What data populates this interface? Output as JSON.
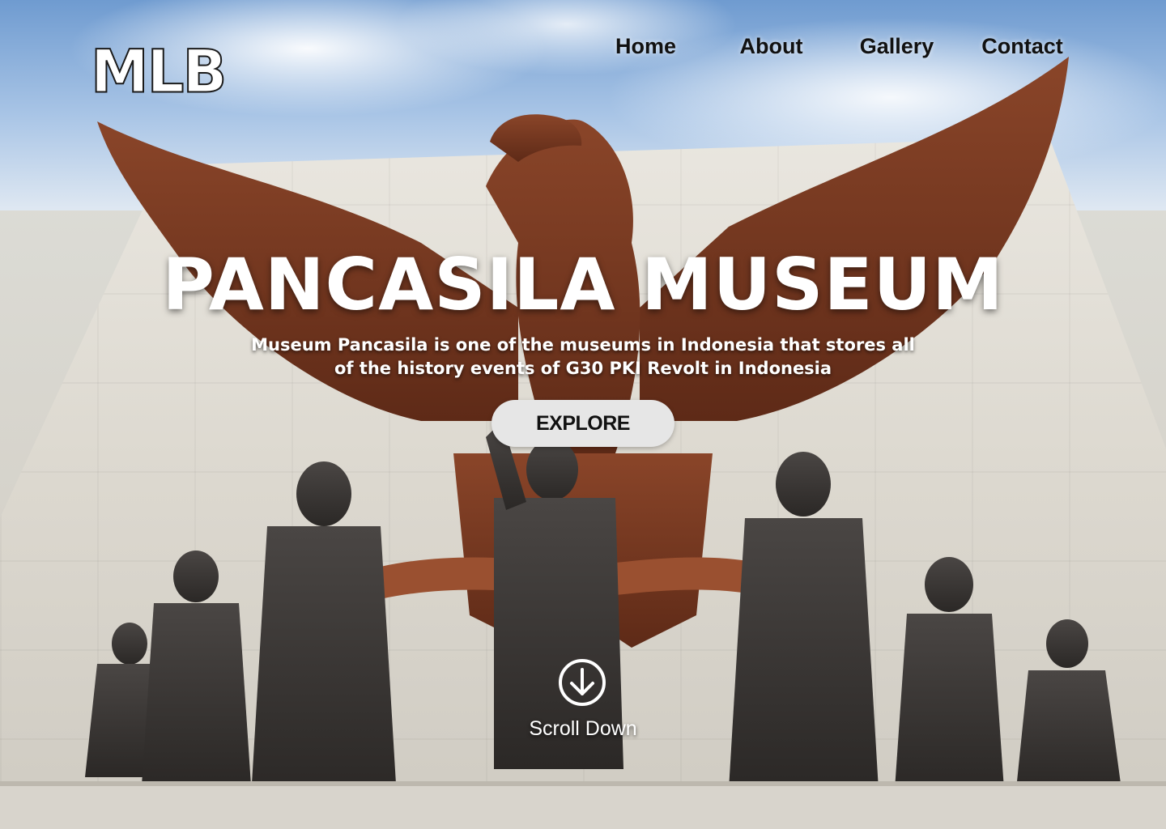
{
  "brand": {
    "logo_text": "MLB"
  },
  "nav": {
    "items": [
      {
        "label": "Home"
      },
      {
        "label": "About"
      },
      {
        "label": "Gallery"
      },
      {
        "label": "Contact"
      }
    ]
  },
  "hero": {
    "title": "PANCASILA MUSEUM",
    "description": "Museum Pancasila is one of the museums in Indonesia that stores all of the history events of G30 PKI Revolt in Indonesia",
    "cta_label": "EXPLORE",
    "scroll_label": "Scroll Down",
    "background_image": "pancasila-monument-eagle-and-statues"
  },
  "colors": {
    "nav_text": "#111111",
    "hero_text": "#ffffff",
    "button_bg": "#e6e6e6",
    "eagle": "#7a3a22"
  }
}
